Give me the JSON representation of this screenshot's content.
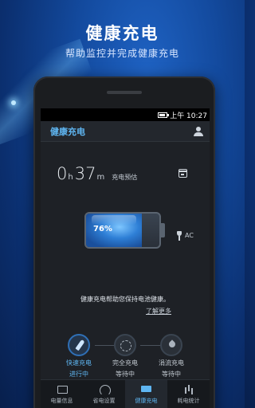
{
  "promo": {
    "title": "健康充电",
    "subtitle": "帮助监控并完成健康充电"
  },
  "statusbar": {
    "time": "上午 10:27"
  },
  "appbar": {
    "title": "健康充电",
    "user_icon": "user-icon"
  },
  "charge": {
    "hours": "0",
    "hours_unit": "h",
    "minutes": "37",
    "minutes_unit": "m",
    "estimate_label": "充电预估",
    "battery_percent": "76%",
    "battery_level": 0.76,
    "source_label": "AC",
    "tip": "健康充电帮助您保持电池健康。",
    "learn_more": "了解更多"
  },
  "steps": [
    {
      "line1": "快速充电",
      "line2": "进行中",
      "icon": "rocket-icon",
      "active": true
    },
    {
      "line1": "完全充电",
      "line2": "等待中",
      "icon": "dashed-circle-icon",
      "active": false
    },
    {
      "line1": "涓流充电",
      "line2": "等待中",
      "icon": "drop-icon",
      "active": false
    }
  ],
  "tabs": [
    {
      "label": "电量信息",
      "icon": "battery-info-icon",
      "active": false
    },
    {
      "label": "省电设置",
      "icon": "gauge-icon",
      "active": false
    },
    {
      "label": "健康充电",
      "icon": "charge-icon",
      "active": true
    },
    {
      "label": "耗电统计",
      "icon": "stats-icon",
      "active": false
    }
  ],
  "colors": {
    "accent": "#5fb6f2",
    "background": "#134a9e",
    "screen": "#1e2126"
  }
}
